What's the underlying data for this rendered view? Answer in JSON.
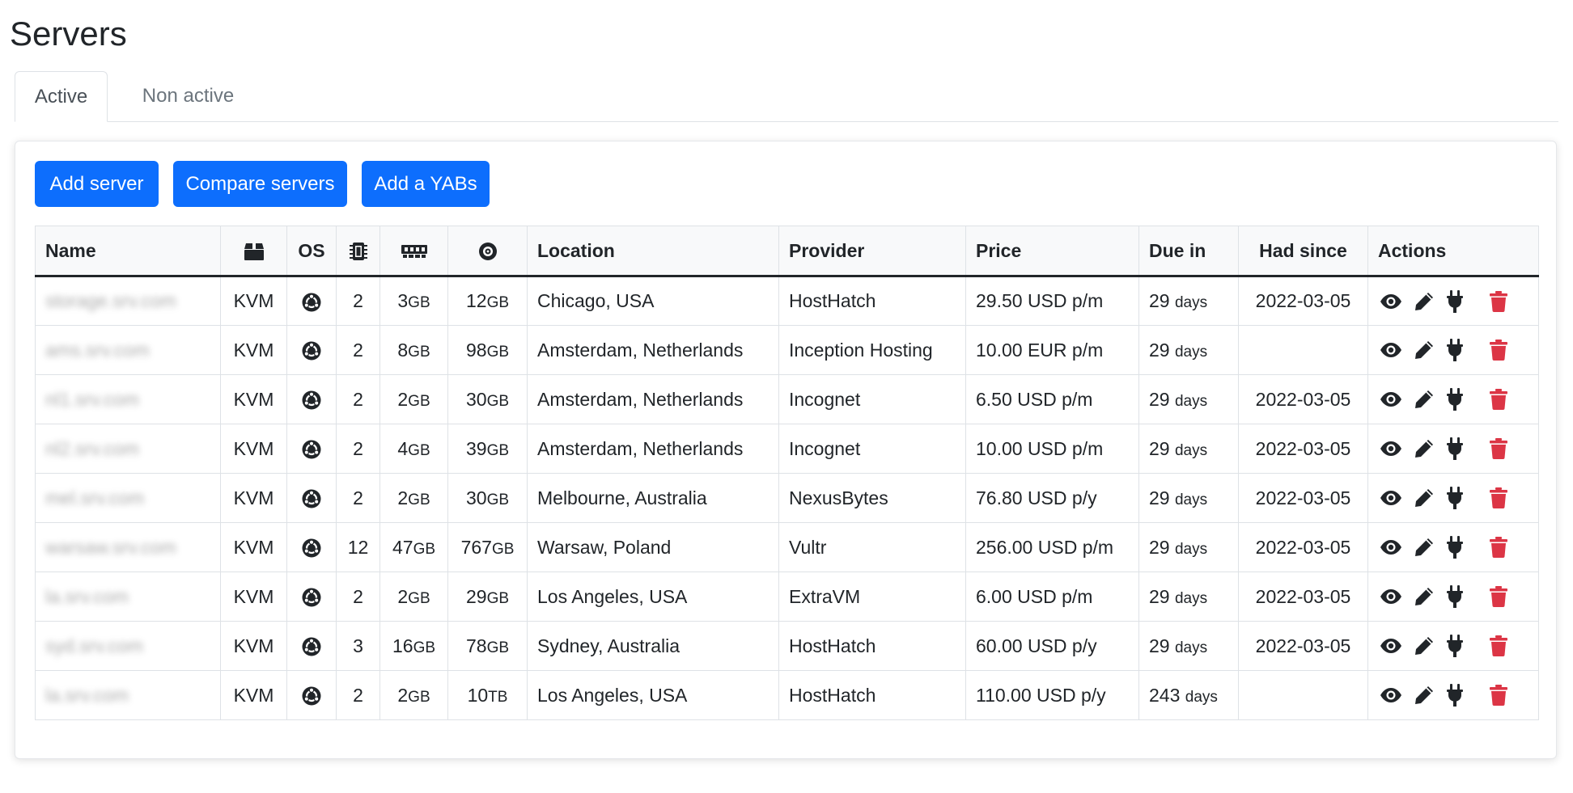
{
  "page": {
    "title": "Servers"
  },
  "tabs": {
    "active": "Active",
    "inactive": "Non active"
  },
  "buttons": {
    "add": "Add server",
    "compare": "Compare servers",
    "yabs": "Add a YABs"
  },
  "table": {
    "headers": {
      "name": "Name",
      "type_icon": "box-icon",
      "os": "OS",
      "cpu_icon": "cpu-chip-icon",
      "ram_icon": "memory-stick-icon",
      "disk_icon": "disk-icon",
      "location": "Location",
      "provider": "Provider",
      "price": "Price",
      "due": "Due in",
      "since": "Had since",
      "actions": "Actions"
    },
    "rows": [
      {
        "name": "storage.srv.com",
        "type": "KVM",
        "cpu": "2",
        "ram": "3",
        "ram_unit": "GB",
        "disk": "12",
        "disk_unit": "GB",
        "location": "Chicago, USA",
        "provider": "HostHatch",
        "price": "29.50 USD p/m",
        "due": "29",
        "due_unit": "days",
        "since": "2022-03-05"
      },
      {
        "name": "ams.srv.com",
        "type": "KVM",
        "cpu": "2",
        "ram": "8",
        "ram_unit": "GB",
        "disk": "98",
        "disk_unit": "GB",
        "location": "Amsterdam, Netherlands",
        "provider": "Inception Hosting",
        "price": "10.00 EUR p/m",
        "due": "29",
        "due_unit": "days",
        "since": ""
      },
      {
        "name": "nl1.srv.com",
        "type": "KVM",
        "cpu": "2",
        "ram": "2",
        "ram_unit": "GB",
        "disk": "30",
        "disk_unit": "GB",
        "location": "Amsterdam, Netherlands",
        "provider": "Incognet",
        "price": "6.50 USD p/m",
        "due": "29",
        "due_unit": "days",
        "since": "2022-03-05"
      },
      {
        "name": "nl2.srv.com",
        "type": "KVM",
        "cpu": "2",
        "ram": "4",
        "ram_unit": "GB",
        "disk": "39",
        "disk_unit": "GB",
        "location": "Amsterdam, Netherlands",
        "provider": "Incognet",
        "price": "10.00 USD p/m",
        "due": "29",
        "due_unit": "days",
        "since": "2022-03-05"
      },
      {
        "name": "mel.srv.com",
        "type": "KVM",
        "cpu": "2",
        "ram": "2",
        "ram_unit": "GB",
        "disk": "30",
        "disk_unit": "GB",
        "location": "Melbourne, Australia",
        "provider": "NexusBytes",
        "price": "76.80 USD p/y",
        "due": "29",
        "due_unit": "days",
        "since": "2022-03-05"
      },
      {
        "name": "warsaw.srv.com",
        "type": "KVM",
        "cpu": "12",
        "ram": "47",
        "ram_unit": "GB",
        "disk": "767",
        "disk_unit": "GB",
        "location": "Warsaw, Poland",
        "provider": "Vultr",
        "price": "256.00 USD p/m",
        "due": "29",
        "due_unit": "days",
        "since": "2022-03-05"
      },
      {
        "name": "la.srv.com",
        "type": "KVM",
        "cpu": "2",
        "ram": "2",
        "ram_unit": "GB",
        "disk": "29",
        "disk_unit": "GB",
        "location": "Los Angeles, USA",
        "provider": "ExtraVM",
        "price": "6.00 USD p/m",
        "due": "29",
        "due_unit": "days",
        "since": "2022-03-05"
      },
      {
        "name": "syd.srv.com",
        "type": "KVM",
        "cpu": "3",
        "ram": "16",
        "ram_unit": "GB",
        "disk": "78",
        "disk_unit": "GB",
        "location": "Sydney, Australia",
        "provider": "HostHatch",
        "price": "60.00 USD p/y",
        "due": "29",
        "due_unit": "days",
        "since": "2022-03-05"
      },
      {
        "name": "la.srv.com",
        "type": "KVM",
        "cpu": "2",
        "ram": "2",
        "ram_unit": "GB",
        "disk": "10",
        "disk_unit": "TB",
        "location": "Los Angeles, USA",
        "provider": "HostHatch",
        "price": "110.00 USD p/y",
        "due": "243",
        "due_unit": "days",
        "since": ""
      }
    ]
  },
  "icons": {
    "os": "ubuntu-icon",
    "view": "eye-icon",
    "edit": "pencil-icon",
    "power": "plug-icon",
    "delete": "trash-icon"
  },
  "colors": {
    "primary": "#0d6efd",
    "danger": "#dc3545",
    "text": "#212529",
    "muted": "#6c757d"
  }
}
